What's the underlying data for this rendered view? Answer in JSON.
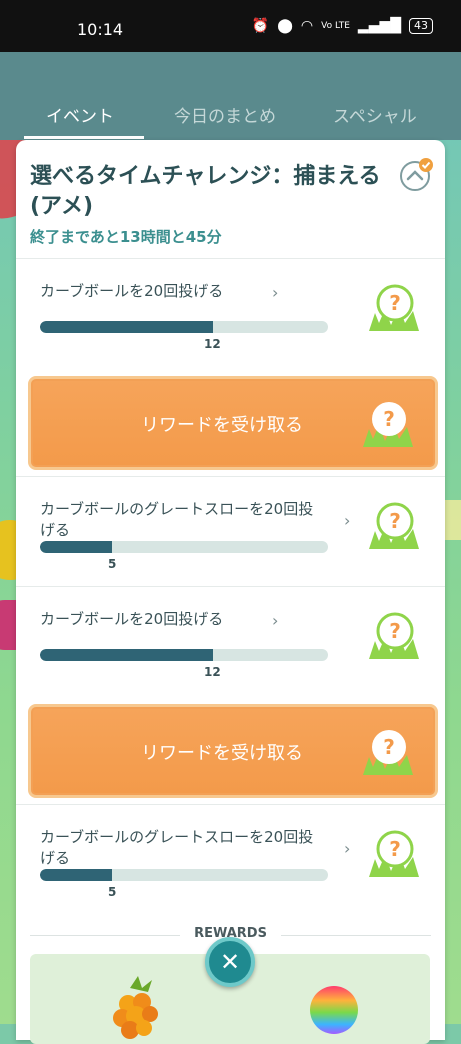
{
  "status_bar": {
    "time": "10:14",
    "battery": "43",
    "net": "Vo LTE"
  },
  "tabs": [
    {
      "label": "イベント",
      "active": true
    },
    {
      "label": "今日のまとめ",
      "active": false
    },
    {
      "label": "スペシャル",
      "active": false
    }
  ],
  "challenge": {
    "title": "選べるタイムチャレンジ：捕まえる(アメ)",
    "timer": "終了まであと13時間と45分"
  },
  "tasks": [
    {
      "label": "カーブボールを20回投げる",
      "progress": 12,
      "goal": 20,
      "count_label": "12",
      "reward": "unknown-pokemon"
    },
    {
      "type": "claim",
      "label": "リワードを受け取る"
    },
    {
      "label": "カーブボールのグレートスローを20回投げる",
      "progress": 5,
      "goal": 20,
      "count_label": "5",
      "reward": "unknown-pokemon"
    },
    {
      "label": "カーブボールを20回投げる",
      "progress": 12,
      "goal": 20,
      "count_label": "12",
      "reward": "unknown-pokemon"
    },
    {
      "type": "claim",
      "label": "リワードを受け取る"
    },
    {
      "label": "カーブボールのグレートスローを20回投げる",
      "progress": 5,
      "goal": 20,
      "count_label": "5",
      "reward": "unknown-pokemon"
    }
  ],
  "rewards_heading": "REWARDS",
  "reward_item_icons": [
    "berry-icon",
    "rainbow-ball-icon"
  ],
  "colors": {
    "accent_orange": "#f39a4a",
    "progress_fill": "#2f6475",
    "header": "#5a8a8d",
    "close_button": "#1f8a90"
  }
}
